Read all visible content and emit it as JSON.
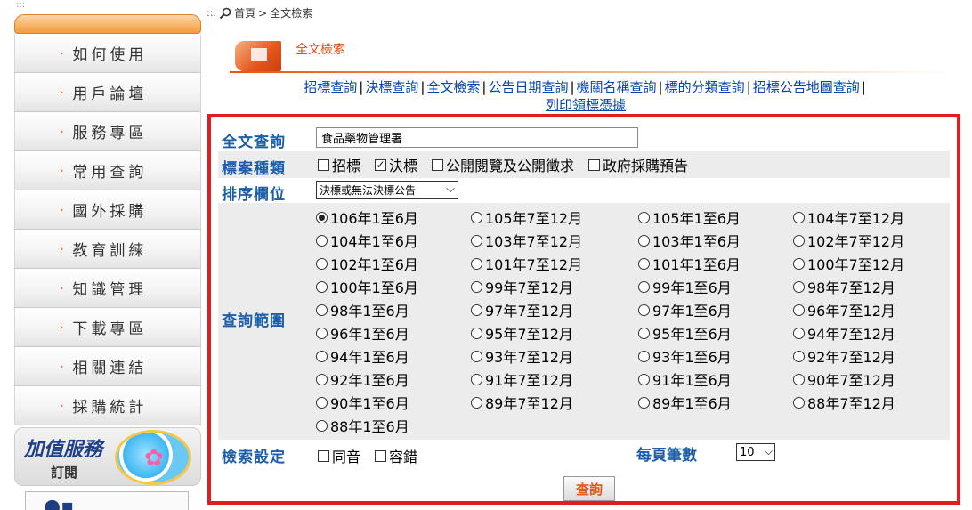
{
  "accessibility_mark": ":::",
  "sidebar": {
    "items": [
      {
        "label": "如何使用"
      },
      {
        "label": "用戶論壇"
      },
      {
        "label": "服務專區"
      },
      {
        "label": "常用查詢"
      },
      {
        "label": "國外採購"
      },
      {
        "label": "教育訓練"
      },
      {
        "label": "知識管理"
      },
      {
        "label": "下載專區"
      },
      {
        "label": "相關連結"
      },
      {
        "label": "採購統計"
      }
    ],
    "promo": {
      "title": "加值服務",
      "subtitle": "訂閱"
    }
  },
  "breadcrumb": {
    "prefix": ":::",
    "home": "首頁",
    "separator": ">",
    "current": "全文檢索"
  },
  "page_title": "全文檢索",
  "nav_links": [
    "招標查詢",
    "決標查詢",
    "全文檢索",
    "公告日期查詢",
    "機關名稱查詢",
    "標的分類查詢",
    "招標公告地圖查詢",
    "列印領標憑據"
  ],
  "form": {
    "keyword_label": "全文查詢",
    "keyword_value": "食品藥物管理署",
    "case_type_label": "標案種類",
    "case_types": [
      {
        "label": "招標",
        "checked": false
      },
      {
        "label": "決標",
        "checked": true
      },
      {
        "label": "公開閱覽及公開徵求",
        "checked": false
      },
      {
        "label": "政府採購預告",
        "checked": false
      }
    ],
    "sort_label": "排序欄位",
    "sort_value": "決標或無法決標公告",
    "range_label": "查詢範圍",
    "periods": [
      {
        "label": "106年1至6月",
        "selected": true
      },
      {
        "label": "105年7至12月",
        "selected": false
      },
      {
        "label": "105年1至6月",
        "selected": false
      },
      {
        "label": "104年7至12月",
        "selected": false
      },
      {
        "label": "104年1至6月",
        "selected": false
      },
      {
        "label": "103年7至12月",
        "selected": false
      },
      {
        "label": "103年1至6月",
        "selected": false
      },
      {
        "label": "102年7至12月",
        "selected": false
      },
      {
        "label": "102年1至6月",
        "selected": false
      },
      {
        "label": "101年7至12月",
        "selected": false
      },
      {
        "label": "101年1至6月",
        "selected": false
      },
      {
        "label": "100年7至12月",
        "selected": false
      },
      {
        "label": "100年1至6月",
        "selected": false
      },
      {
        "label": "99年7至12月",
        "selected": false
      },
      {
        "label": "99年1至6月",
        "selected": false
      },
      {
        "label": "98年7至12月",
        "selected": false
      },
      {
        "label": "98年1至6月",
        "selected": false
      },
      {
        "label": "97年7至12月",
        "selected": false
      },
      {
        "label": "97年1至6月",
        "selected": false
      },
      {
        "label": "96年7至12月",
        "selected": false
      },
      {
        "label": "96年1至6月",
        "selected": false
      },
      {
        "label": "95年7至12月",
        "selected": false
      },
      {
        "label": "95年1至6月",
        "selected": false
      },
      {
        "label": "94年7至12月",
        "selected": false
      },
      {
        "label": "94年1至6月",
        "selected": false
      },
      {
        "label": "93年7至12月",
        "selected": false
      },
      {
        "label": "93年1至6月",
        "selected": false
      },
      {
        "label": "92年7至12月",
        "selected": false
      },
      {
        "label": "92年1至6月",
        "selected": false
      },
      {
        "label": "91年7至12月",
        "selected": false
      },
      {
        "label": "91年1至6月",
        "selected": false
      },
      {
        "label": "90年7至12月",
        "selected": false
      },
      {
        "label": "90年1至6月",
        "selected": false
      },
      {
        "label": "89年7至12月",
        "selected": false
      },
      {
        "label": "89年1至6月",
        "selected": false
      },
      {
        "label": "88年7至12月",
        "selected": false
      },
      {
        "label": "88年1至6月",
        "selected": false
      }
    ],
    "settings_label": "檢索設定",
    "settings": [
      {
        "label": "同音",
        "checked": false
      },
      {
        "label": "容錯",
        "checked": false
      }
    ],
    "per_page_label": "每頁筆數",
    "per_page_value": "10",
    "submit_label": "查詢"
  },
  "colors": {
    "accent": "#e21c23",
    "label_blue": "#1d5ea8",
    "link_blue": "#0645ad",
    "orange": "#e24c0f"
  }
}
